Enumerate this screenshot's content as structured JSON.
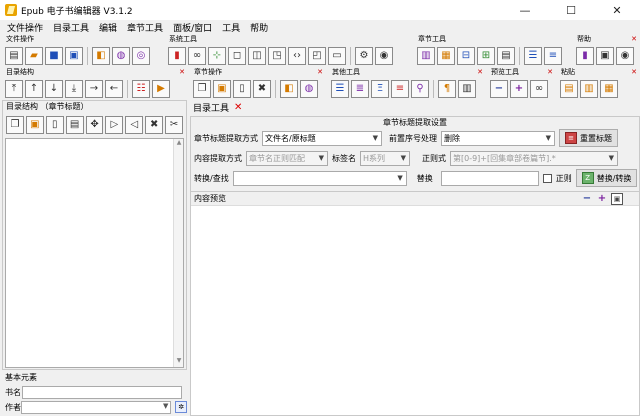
{
  "window": {
    "title": "Epub 电子书编辑器 V3.1.2",
    "minimize": "—",
    "maximize": "☐",
    "close": "✕"
  },
  "menu": [
    "文件操作",
    "目录工具",
    "编辑",
    "章节工具",
    "面板/窗口",
    "工具",
    "帮助"
  ],
  "toolbars": {
    "file_ops": {
      "label": "文件操作"
    },
    "system_tools": {
      "label": "系统工具"
    },
    "chapter_tools": {
      "label": "章节工具"
    },
    "help": {
      "label": "帮助"
    },
    "toc_structure": {
      "label": "目录结构"
    },
    "chapter_ops": {
      "label": "章节操作"
    },
    "other_tools": {
      "label": "其他工具"
    },
    "preview_tools": {
      "label": "预览工具"
    },
    "paste": {
      "label": "粘贴"
    }
  },
  "left_panel": {
    "title": "目录结构 （章节标题）"
  },
  "basic_elements": {
    "title": "基本元素",
    "book_name_label": "书名",
    "book_name_value": "",
    "author_label": "作者",
    "author_value": ""
  },
  "toc_tool": {
    "tab_title": "目录工具",
    "settings_title": "章节标题提取设置",
    "extract_method_label": "章节标题提取方式",
    "extract_method_value": "文件名/原标题",
    "prefix_label": "前置序号处理",
    "prefix_value": "删除",
    "reset_button": "重置标题",
    "content_method_label": "内容提取方式",
    "content_method_value": "章节名正则匹配",
    "tag_label": "标签名",
    "tag_value": "H系列",
    "regex_label": "正则式",
    "regex_value": "第[0-9]+[回集章部卷篇节].*",
    "convert_label": "转换/查找",
    "convert_value": "",
    "replace_label": "替换",
    "replace_value": "",
    "regex_checkbox_label": "正则",
    "replace_button": "替换/转换"
  },
  "preview": {
    "title": "内容预览"
  }
}
